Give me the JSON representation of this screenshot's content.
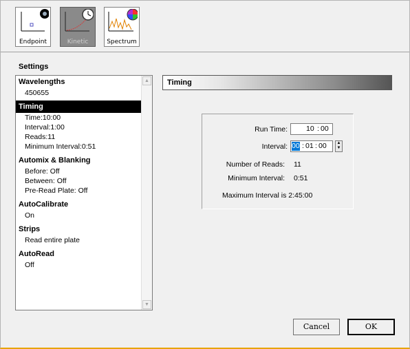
{
  "toolbar": {
    "modes": [
      {
        "label": "Endpoint",
        "icon": "endpoint-icon"
      },
      {
        "label": "Kinetic",
        "icon": "kinetic-icon"
      },
      {
        "label": "Spectrum",
        "icon": "spectrum-icon"
      }
    ],
    "active_mode": "Kinetic"
  },
  "settings": {
    "title": "Settings",
    "sections": [
      {
        "heading": "Wavelengths",
        "items": [
          "450655"
        ]
      },
      {
        "heading": "Timing",
        "items": [
          "Time:10:00",
          "Interval:1:00",
          "Reads:11",
          "Minimum Interval:0:51"
        ]
      },
      {
        "heading": "Automix & Blanking",
        "items": [
          "Before: Off",
          "Between: Off",
          "Pre-Read Plate: Off"
        ]
      },
      {
        "heading": "AutoCalibrate",
        "items": [
          "On"
        ]
      },
      {
        "heading": "Strips",
        "items": [
          "Read entire plate"
        ]
      },
      {
        "heading": "AutoRead",
        "items": [
          "Off"
        ]
      }
    ],
    "selected_section": "Timing"
  },
  "panel": {
    "title": "Timing",
    "run_time_label": "Run Time:",
    "run_time_min": "10",
    "run_time_sep": ":",
    "run_time_sec": "00",
    "interval_label": "Interval:",
    "interval_h": "00",
    "interval_sep1": ":",
    "interval_m": "01",
    "interval_sep2": ":",
    "interval_s": "00",
    "reads_label": "Number of Reads:",
    "reads_value": "11",
    "min_interval_label": "Minimum Interval:",
    "min_interval_value": "0:51",
    "max_interval_text": "Maximum Interval is 2:45:00"
  },
  "buttons": {
    "cancel": "Cancel",
    "ok": "OK"
  },
  "colors": {
    "selected_bg": "#000000",
    "highlight": "#0078d7",
    "bottom_border": "#e7a400"
  }
}
